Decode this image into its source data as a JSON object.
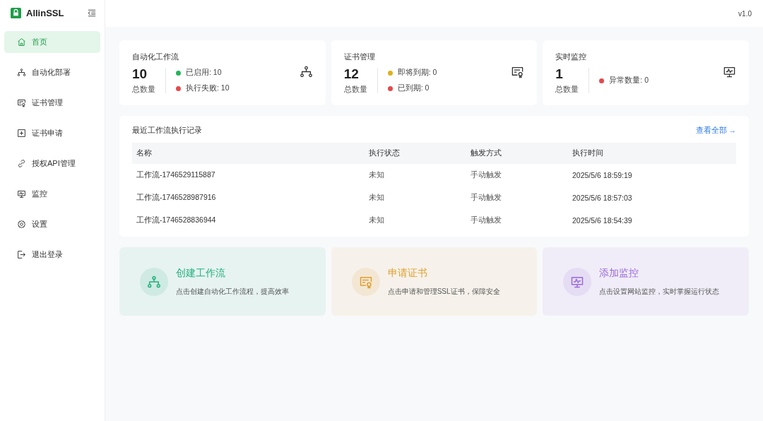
{
  "sidebar": {
    "brand": "AllinSSL",
    "items": [
      {
        "label": "首页",
        "selected": true
      },
      {
        "label": "自动化部署",
        "selected": false
      },
      {
        "label": "证书管理",
        "selected": false
      },
      {
        "label": "证书申请",
        "selected": false
      },
      {
        "label": "授权API管理",
        "selected": false
      },
      {
        "label": "监控",
        "selected": false
      },
      {
        "label": "设置",
        "selected": false
      },
      {
        "label": "退出登录",
        "selected": false
      }
    ]
  },
  "version": "v1.0",
  "stat_cards": [
    {
      "title": "自动化工作流",
      "value": "10",
      "value_label": "总数量",
      "stats": [
        {
          "text": "已启用: 10",
          "color": "#22b45a"
        },
        {
          "text": "执行失败: 10",
          "color": "#e5484d"
        }
      ]
    },
    {
      "title": "证书管理",
      "value": "12",
      "value_label": "总数量",
      "stats": [
        {
          "text": "即将到期: 0",
          "color": "#e0b01c"
        },
        {
          "text": "已到期: 0",
          "color": "#e5484d"
        }
      ]
    },
    {
      "title": "实时监控",
      "value": "1",
      "value_label": "总数量",
      "stats": [
        {
          "text": "异常数量: 0",
          "color": "#e5484d"
        }
      ]
    }
  ],
  "recent": {
    "title": "最近工作流执行记录",
    "link": "查看全部 →",
    "columns": [
      "名称",
      "执行状态",
      "触发方式",
      "执行时间"
    ],
    "rows": [
      [
        "工作流-1746529115887",
        "未知",
        "手动触发",
        "2025/5/6 18:59:19"
      ],
      [
        "工作流-1746528987916",
        "未知",
        "手动触发",
        "2025/5/6 18:57:03"
      ],
      [
        "工作流-1746528836944",
        "未知",
        "手动触发",
        "2025/5/6 18:54:39"
      ]
    ]
  },
  "quick_actions": [
    {
      "title": "创建工作流",
      "description": "点击创建自动化工作流程，提高效率",
      "color": "#22b07d"
    },
    {
      "title": "申请证书",
      "description": "点击申请和管理SSL证书，保障安全",
      "color": "#e0a030"
    },
    {
      "title": "添加监控",
      "description": "点击设置网站监控，实时掌握运行状态",
      "color": "#9b6ad8"
    }
  ]
}
